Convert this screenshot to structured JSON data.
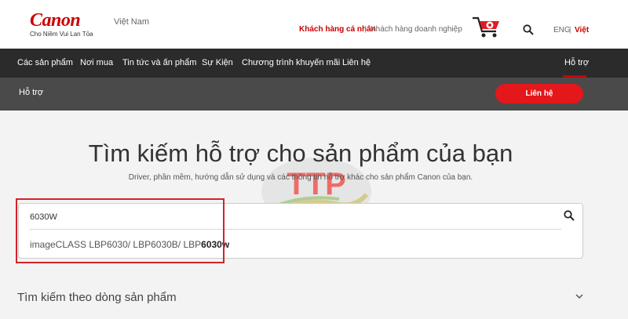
{
  "header": {
    "brand": "Canon",
    "tagline": "Cho Niềm Vui Lan Tỏa",
    "country": "Việt Nam",
    "segments": {
      "personal": "Khách hàng cá nhân",
      "separator": "|",
      "business": "Khách hàng doanh nghiệp"
    },
    "lang": {
      "en": "ENG",
      "separator": "|",
      "vn": "Việt"
    }
  },
  "nav": {
    "items": [
      {
        "label": "Các sản phẩm"
      },
      {
        "label": "Nơi mua"
      },
      {
        "label": "Tin tức và ấn phẩm"
      },
      {
        "label": "Sự Kiện"
      },
      {
        "label": "Chương trình khuyến mãi"
      },
      {
        "label": "Liên hệ"
      }
    ],
    "support": "Hỗ trợ"
  },
  "subnav": {
    "title": "Hỗ trợ",
    "contact_button": "Liên hệ"
  },
  "main": {
    "title": "Tìm kiếm hỗ trợ cho sản phẩm của bạn",
    "subtitle": "Driver, phần mềm, hướng dẫn sử dụng và các thông tin hỗ trợ khác cho sản phẩm Canon của bạn.",
    "search": {
      "value": "6030W",
      "suggestion_prefix": "imageCLASS LBP6030/ LBP6030B/ LBP",
      "suggestion_match": "6030w"
    },
    "section_title": "Tìm kiếm theo dòng sản phẩm"
  },
  "watermark": {
    "text": "TTP"
  },
  "colors": {
    "brand_red": "#cc0000",
    "nav_bg": "#2b2b2b",
    "subnav_bg": "#4a4a4a",
    "button_red": "#e4171b"
  }
}
